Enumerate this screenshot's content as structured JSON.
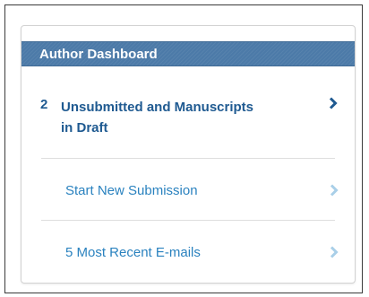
{
  "dashboard": {
    "title": "Author Dashboard",
    "main_item": {
      "count": "2",
      "label": "Unsubmitted and Manuscripts in Draft"
    },
    "links": [
      {
        "label": "Start New Submission"
      },
      {
        "label": "5 Most Recent E-mails"
      }
    ]
  },
  "colors": {
    "header": "#4c7aa8",
    "main_text": "#1f5a91",
    "link_text": "#2a82bf",
    "chevron_light": "#a9cfe8"
  },
  "icons": {
    "main_arrow": "chevron-right-icon",
    "link_arrow": "chevron-right-icon"
  }
}
